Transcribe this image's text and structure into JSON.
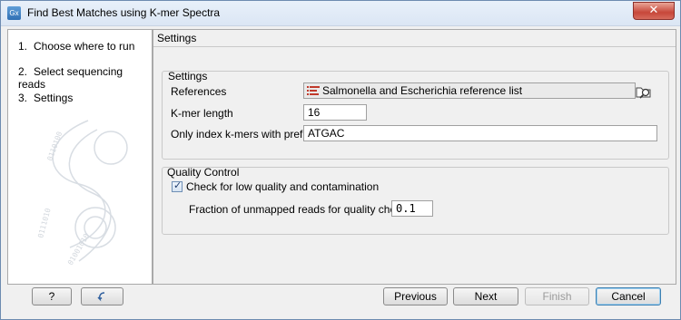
{
  "window": {
    "title": "Find Best Matches using K-mer Spectra",
    "icon_label": "Gx",
    "close_label": "✕"
  },
  "steps": [
    {
      "num": "1.",
      "label": "Choose where to run"
    },
    {
      "num": "2.",
      "label": "Select sequencing reads"
    },
    {
      "num": "3.",
      "label": "Settings"
    }
  ],
  "main": {
    "heading": "Settings",
    "settings_group": {
      "title": "Settings",
      "references_label": "References",
      "references_value": "Salmonella and Escherichia reference list",
      "kmer_length_label": "K-mer length",
      "kmer_length_value": "16",
      "prefix_label": "Only index k-mers with prefix",
      "prefix_value": "ATGAC"
    },
    "quality_group": {
      "title": "Quality Control",
      "check_label": "Check for low quality and contamination",
      "check_checked": true,
      "fraction_label": "Fraction of unmapped reads for quality check",
      "fraction_value": "0.1"
    }
  },
  "buttons": {
    "help": "?",
    "previous": "Previous",
    "next": "Next",
    "finish": "Finish",
    "cancel": "Cancel"
  },
  "icons": [
    "app-icon",
    "close-icon",
    "list-icon",
    "browse-icon",
    "help-icon",
    "reset-icon",
    "checkmark-icon"
  ]
}
